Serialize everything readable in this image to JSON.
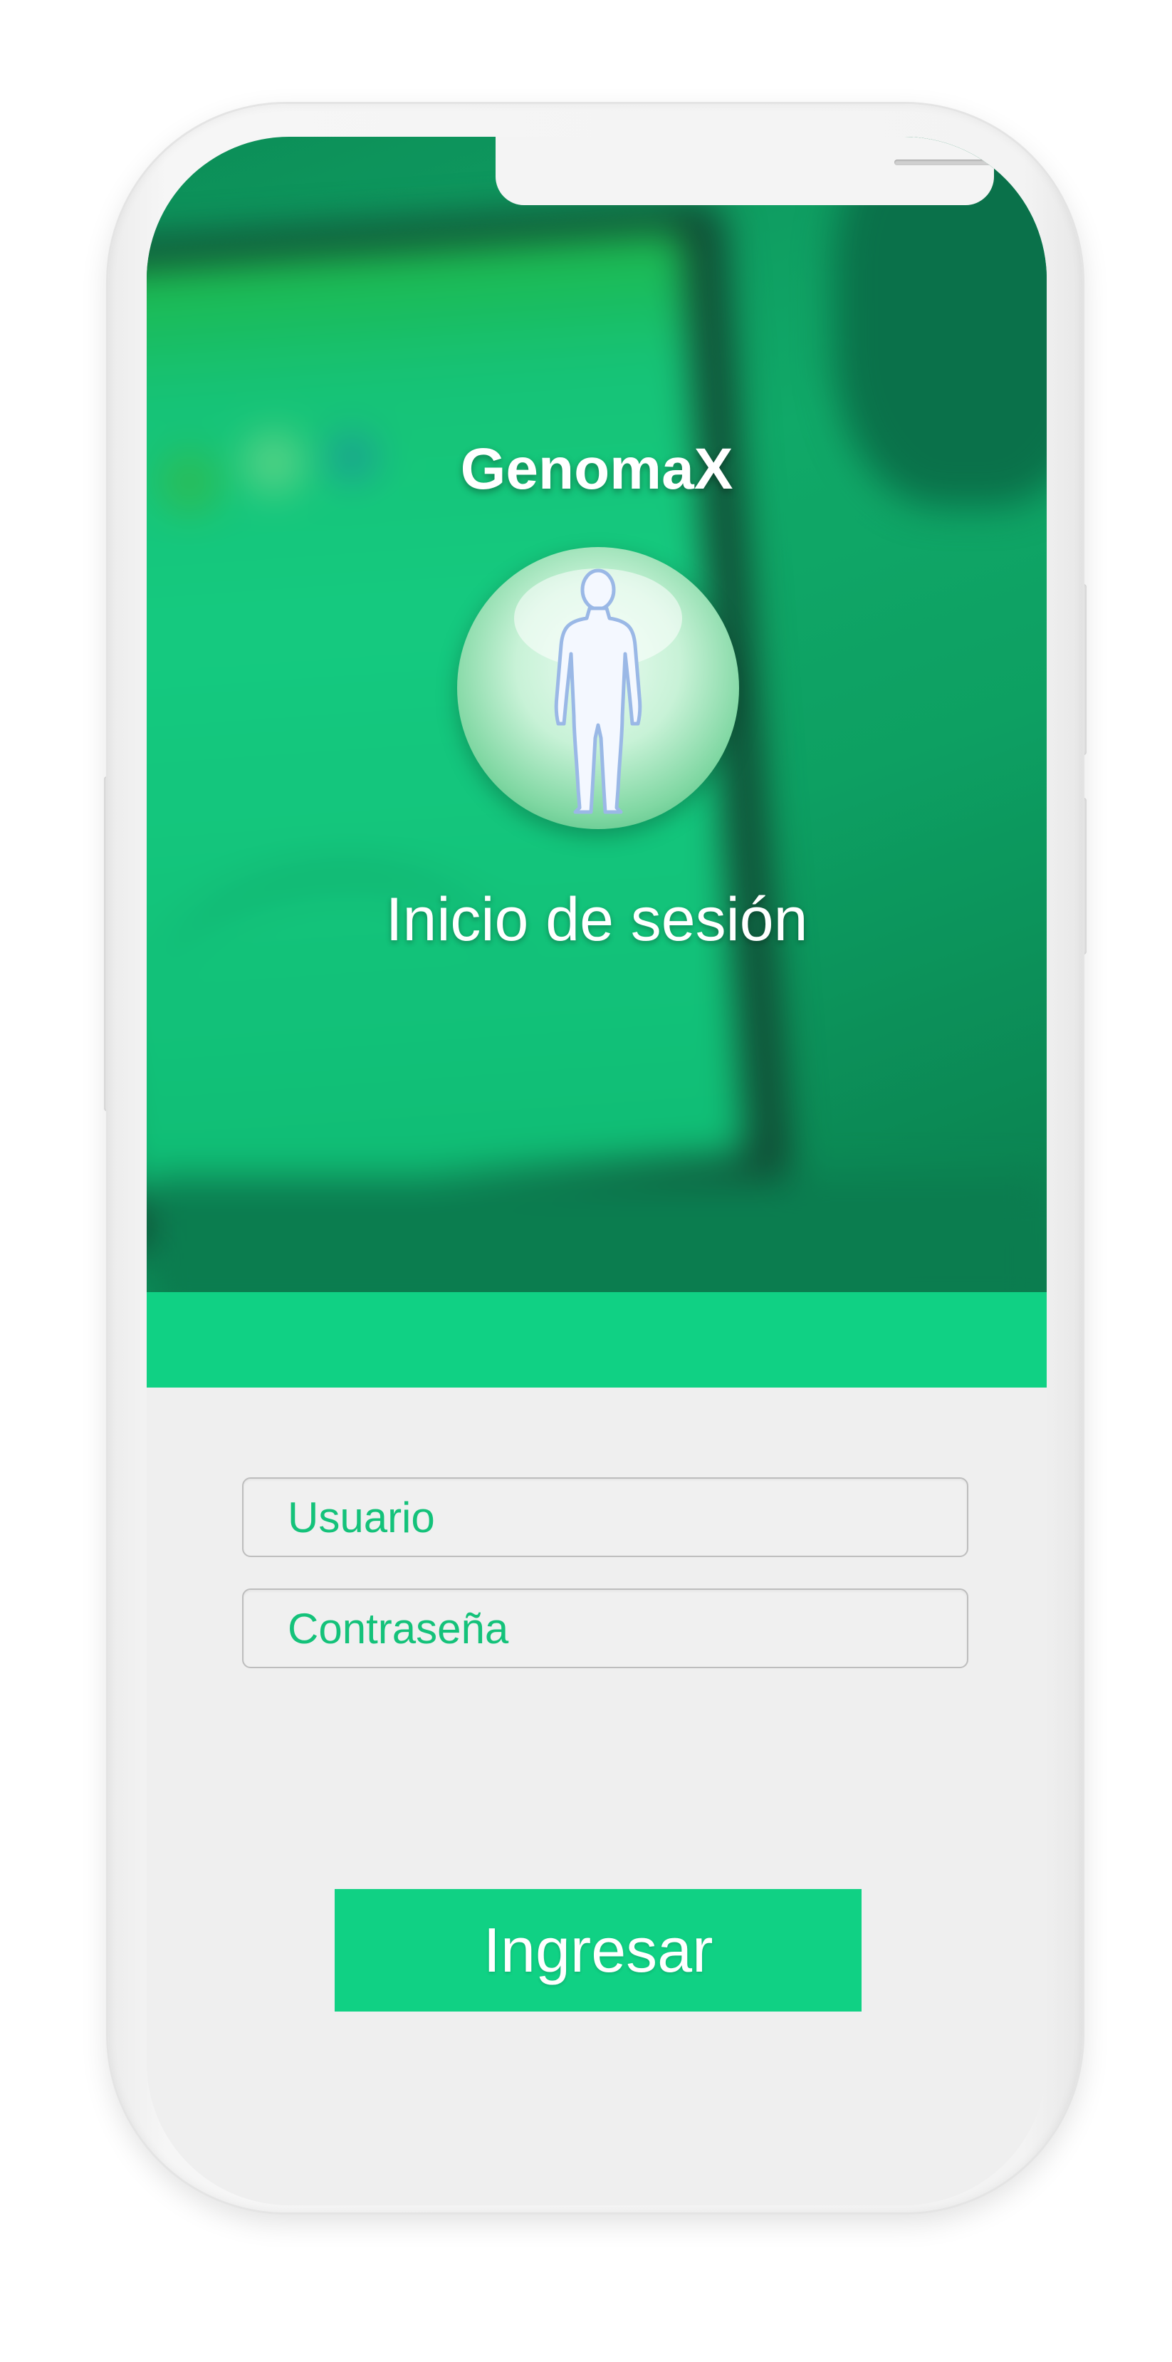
{
  "app": {
    "title": "GenomaX",
    "screen_title": "Inicio de sesión"
  },
  "form": {
    "username_placeholder": "Usuario",
    "password_placeholder": "Contraseña",
    "submit_label": "Ingresar"
  },
  "icons": {
    "avatar": "human-body-icon"
  },
  "colors": {
    "accent": "#10d184",
    "hero_dark": "#0b7b4c",
    "placeholder": "#14c27a",
    "background": "#efefef"
  }
}
